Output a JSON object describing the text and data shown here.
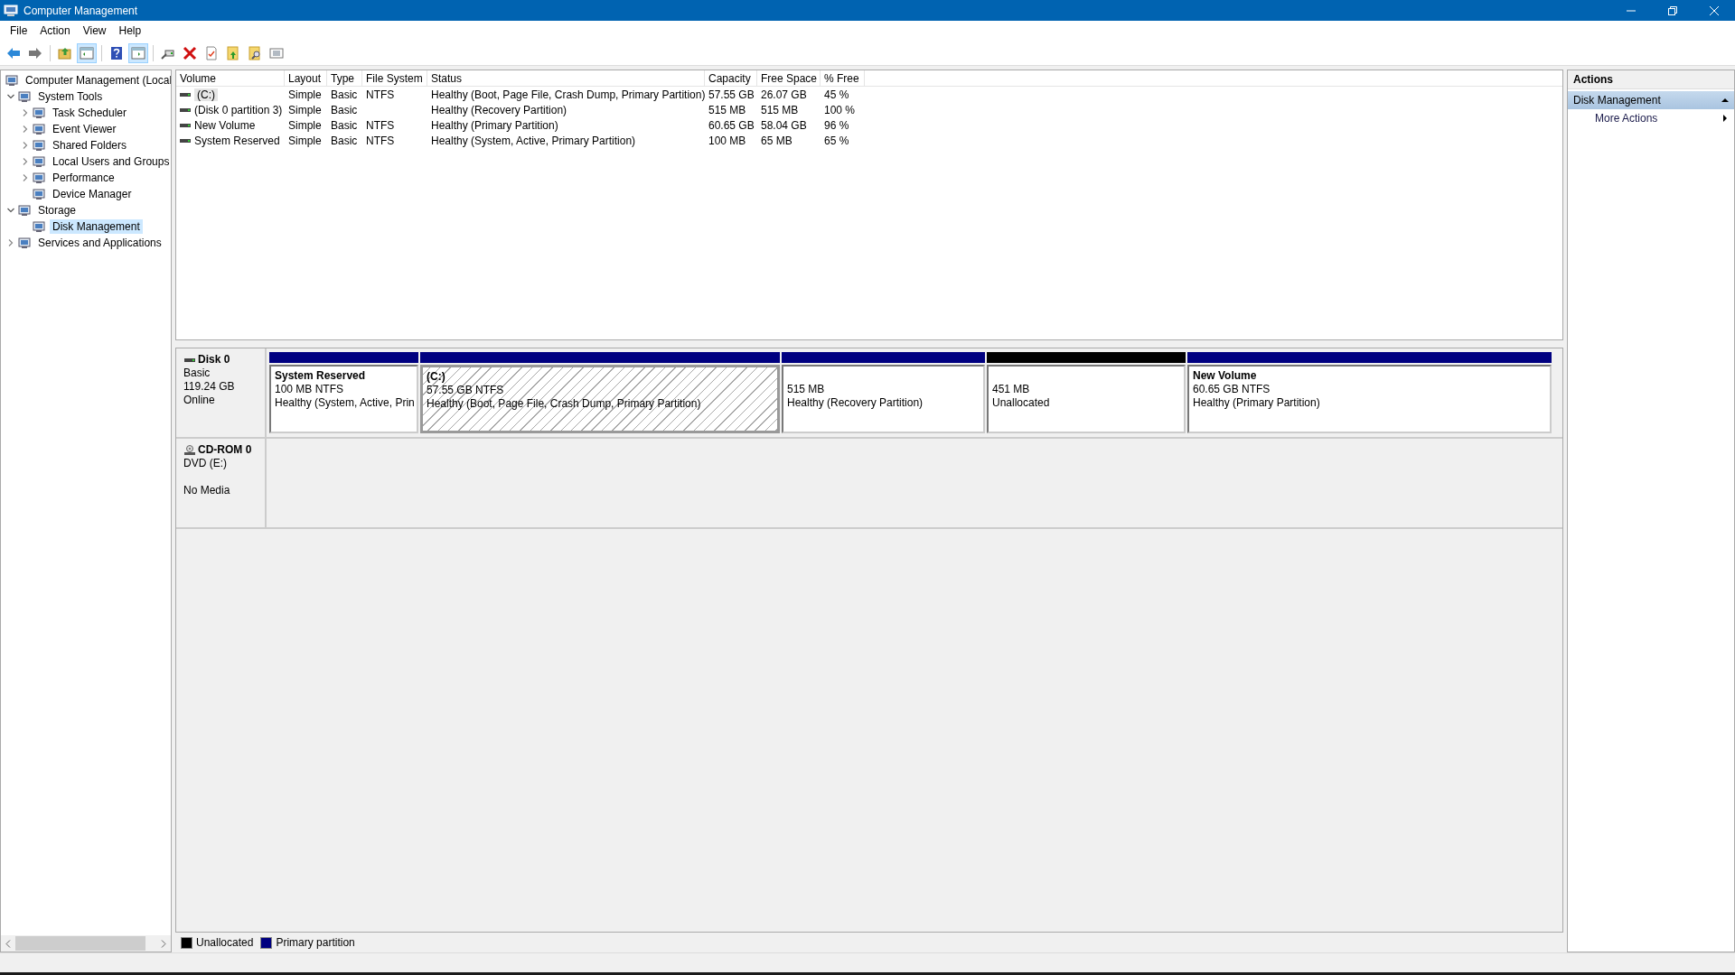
{
  "window": {
    "title": "Computer Management"
  },
  "menu": [
    "File",
    "Action",
    "View",
    "Help"
  ],
  "toolbar": [
    {
      "kind": "back",
      "on": false
    },
    {
      "kind": "forward",
      "on": false
    },
    {
      "kind": "sep"
    },
    {
      "kind": "up",
      "on": false
    },
    {
      "kind": "tree",
      "on": true
    },
    {
      "kind": "sep"
    },
    {
      "kind": "help",
      "on": false
    },
    {
      "kind": "pane",
      "on": true
    },
    {
      "kind": "sep"
    },
    {
      "kind": "connect",
      "on": false
    },
    {
      "kind": "delete",
      "on": false
    },
    {
      "kind": "properties",
      "on": false
    },
    {
      "kind": "export",
      "on": false
    },
    {
      "kind": "find",
      "on": false
    },
    {
      "kind": "list",
      "on": false
    }
  ],
  "tree": {
    "label": "Computer Management (Local",
    "selected": false,
    "children": [
      {
        "label": "System Tools",
        "expanded": true,
        "selected": false,
        "children": [
          {
            "label": "Task Scheduler",
            "expanded": false,
            "selected": false
          },
          {
            "label": "Event Viewer",
            "expanded": false,
            "selected": false
          },
          {
            "label": "Shared Folders",
            "expanded": false,
            "selected": false
          },
          {
            "label": "Local Users and Groups",
            "expanded": false,
            "selected": false
          },
          {
            "label": "Performance",
            "expanded": false,
            "selected": false
          },
          {
            "label": "Device Manager",
            "selected": false
          }
        ]
      },
      {
        "label": "Storage",
        "expanded": true,
        "selected": false,
        "children": [
          {
            "label": "Disk Management",
            "selected": true
          }
        ]
      },
      {
        "label": "Services and Applications",
        "expanded": false,
        "selected": false
      }
    ]
  },
  "table": {
    "columns": [
      "Volume",
      "Layout",
      "Type",
      "File System",
      "Status",
      "Capacity",
      "Free Space",
      "% Free"
    ],
    "rows": [
      {
        "selected": true,
        "cells": [
          "(C:)",
          "Simple",
          "Basic",
          "NTFS",
          "Healthy (Boot, Page File, Crash Dump, Primary Partition)",
          "57.55 GB",
          "26.07 GB",
          "45 %"
        ]
      },
      {
        "selected": false,
        "cells": [
          "(Disk 0 partition 3)",
          "Simple",
          "Basic",
          "",
          "Healthy (Recovery Partition)",
          "515 MB",
          "515 MB",
          "100 %"
        ]
      },
      {
        "selected": false,
        "cells": [
          "New Volume",
          "Simple",
          "Basic",
          "NTFS",
          "Healthy (Primary Partition)",
          "60.65 GB",
          "58.04 GB",
          "96 %"
        ]
      },
      {
        "selected": false,
        "cells": [
          "System Reserved",
          "Simple",
          "Basic",
          "NTFS",
          "Healthy (System, Active, Primary Partition)",
          "100 MB",
          "65 MB",
          "65 %"
        ]
      }
    ]
  },
  "disks": [
    {
      "kind": "disk",
      "name": "Disk 0",
      "type": "Basic",
      "size": "119.24 GB",
      "status": "Online",
      "partitions": [
        {
          "name": "System Reserved",
          "size": "100 MB NTFS",
          "status": "Healthy (System, Active, Prin",
          "color": "#000080",
          "selected": false
        },
        {
          "name": "(C:)",
          "size": "57.55 GB NTFS",
          "status": "Healthy (Boot, Page File, Crash Dump, Primary Partition)",
          "color": "#000080",
          "selected": true
        },
        {
          "size": "515 MB",
          "status": "Healthy (Recovery Partition)",
          "color": "#000080",
          "selected": false
        },
        {
          "size": "451 MB",
          "status": "Unallocated",
          "color": "#000000",
          "selected": false
        },
        {
          "name": "New Volume",
          "size": "60.65 GB NTFS",
          "status": "Healthy (Primary Partition)",
          "color": "#000080",
          "selected": false
        }
      ]
    },
    {
      "kind": "cdrom",
      "name": "CD-ROM 0",
      "type": "DVD (E:)",
      "status": "No Media"
    }
  ],
  "legend": [
    {
      "label": "Unallocated",
      "color": "#000000"
    },
    {
      "label": "Primary partition",
      "color": "#000080"
    }
  ],
  "actions": {
    "title": "Actions",
    "section": {
      "label": "Disk Management",
      "expanded": true
    },
    "items": [
      "More Actions"
    ]
  }
}
